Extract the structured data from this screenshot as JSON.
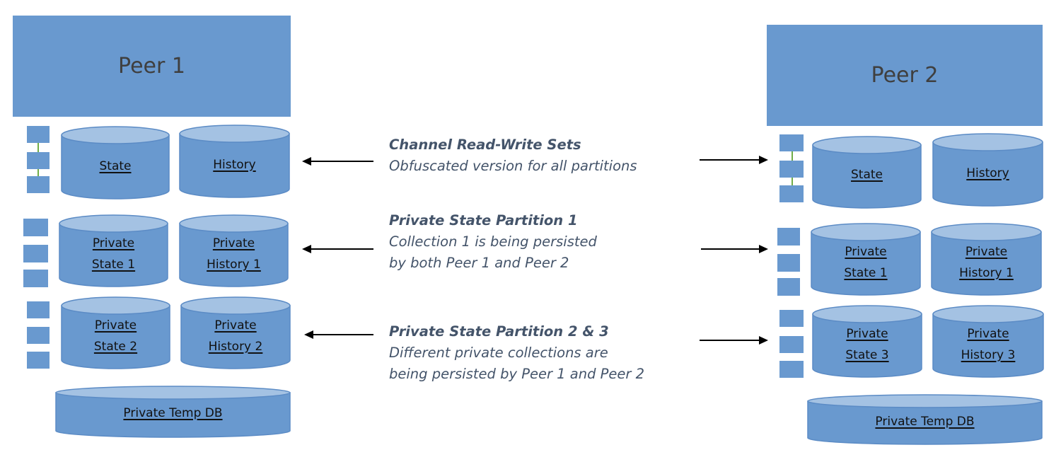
{
  "colors": {
    "box_fill": "#6999cf",
    "cylinder_top": "#a4c2e3",
    "cylinder_stroke": "#5b8bc5",
    "connector": "#70ad47",
    "annotation_text": "#44546a",
    "arrow": "#000000"
  },
  "peer1": {
    "title": "Peer 1",
    "state": "State",
    "history": "History",
    "private_state_a": [
      "Private",
      "State 1"
    ],
    "private_history_a": [
      "Private",
      "History 1"
    ],
    "private_state_b": [
      "Private",
      "State 2"
    ],
    "private_history_b": [
      "Private",
      "History 2"
    ],
    "temp_db": "Private Temp DB"
  },
  "peer2": {
    "title": "Peer 2",
    "state": "State",
    "history": "History",
    "private_state_a": [
      "Private",
      "State 1"
    ],
    "private_history_a": [
      "Private",
      "History 1"
    ],
    "private_state_b": [
      "Private",
      "State 3"
    ],
    "private_history_b": [
      "Private",
      "History 3"
    ],
    "temp_db": "Private Temp DB"
  },
  "annotations": [
    {
      "heading": "Channel Read-Write Sets",
      "lines": [
        "Obfuscated version for all partitions"
      ]
    },
    {
      "heading": "Private State Partition 1",
      "lines": [
        "Collection 1 is being persisted",
        "by both Peer 1 and Peer 2"
      ]
    },
    {
      "heading": "Private State Partition 2 & 3",
      "lines": [
        "Different private collections are",
        "being persisted by Peer 1 and Peer 2"
      ]
    }
  ]
}
